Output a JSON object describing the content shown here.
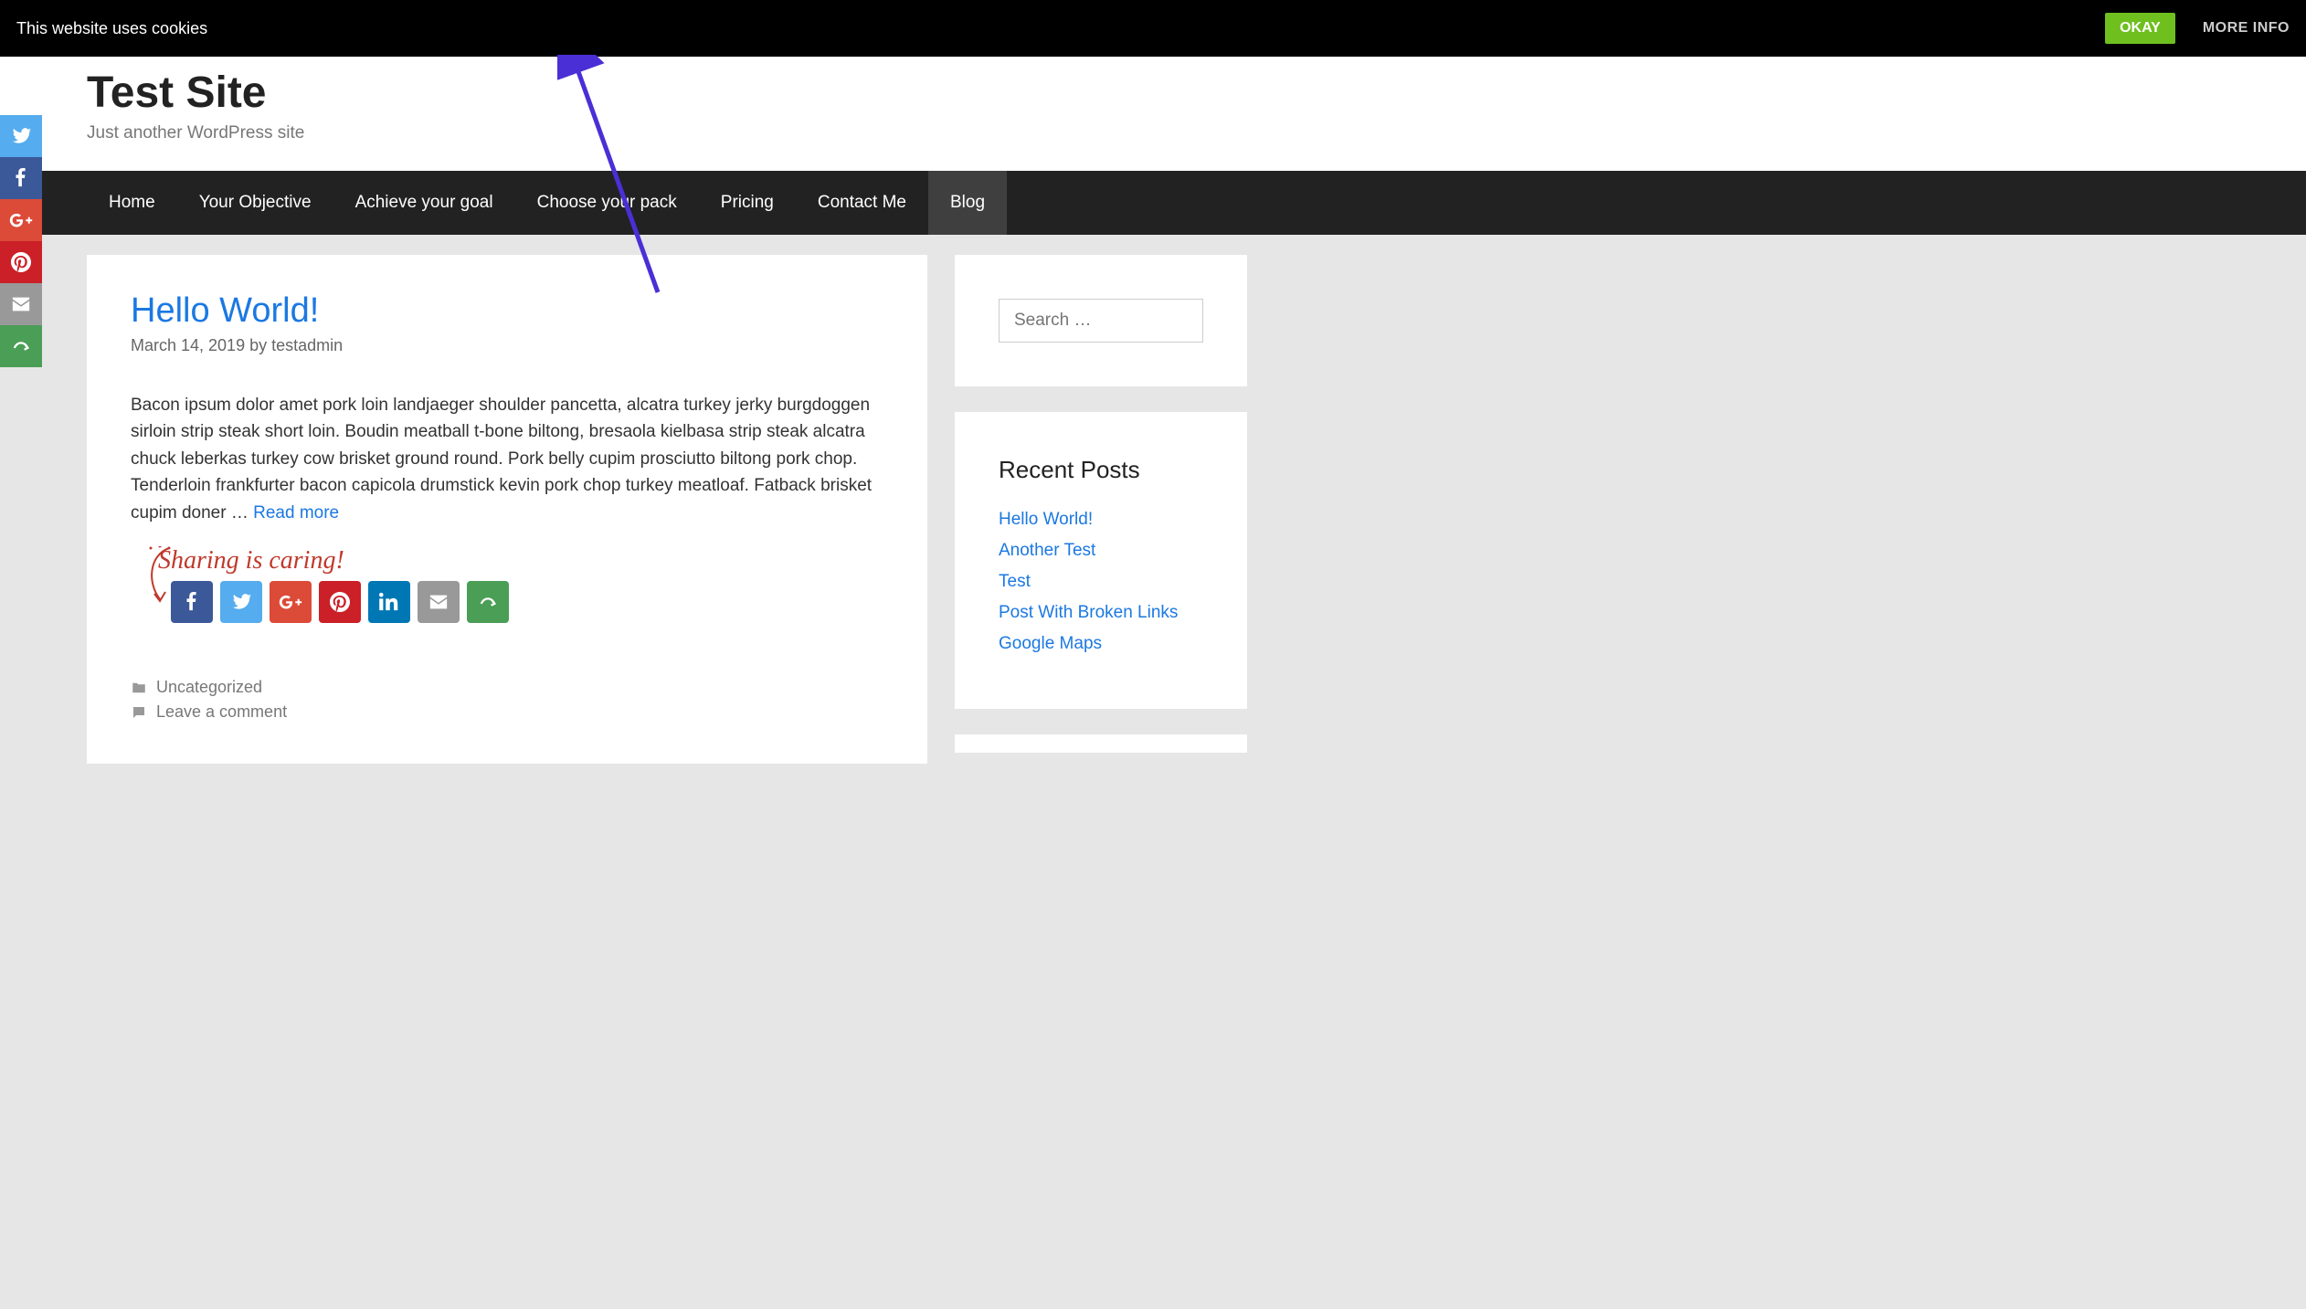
{
  "cookie": {
    "text": "This website uses cookies",
    "okay": "OKAY",
    "more": "MORE INFO"
  },
  "site": {
    "title": "Test Site",
    "tagline": "Just another WordPress site"
  },
  "nav": {
    "items": [
      "Home",
      "Your Objective",
      "Achieve your goal",
      "Choose your pack",
      "Pricing",
      "Contact Me",
      "Blog"
    ],
    "active_index": 6
  },
  "post": {
    "title": "Hello World!",
    "date": "March 14, 2019",
    "by_prefix": "by",
    "author": "testadmin",
    "excerpt": "Bacon ipsum dolor amet pork loin landjaeger shoulder pancetta, alcatra turkey jerky burgdoggen sirloin strip steak short loin. Boudin meatball t-bone biltong, bresaola kielbasa strip steak alcatra chuck leberkas turkey cow brisket ground round. Pork belly cupim prosciutto biltong pork chop. Tenderloin frankfurter bacon capicola drumstick kevin pork chop turkey meatloaf. Fatback brisket cupim doner … ",
    "read_more": "Read more",
    "sharing_label": "Sharing is caring!",
    "category": "Uncategorized",
    "comment_label": "Leave a comment"
  },
  "share_buttons": [
    "facebook",
    "twitter",
    "google-plus",
    "pinterest",
    "linkedin",
    "email",
    "more"
  ],
  "side_share": [
    "twitter",
    "facebook",
    "google-plus",
    "pinterest",
    "email",
    "more"
  ],
  "sidebar": {
    "search_placeholder": "Search …",
    "recent_title": "Recent Posts",
    "recent": [
      "Hello World!",
      "Another Test",
      "Test",
      "Post With Broken Links",
      "Google Maps"
    ]
  },
  "colors": {
    "accent": "#1b78e2",
    "okay_bg": "#6fbf1f",
    "sharing_text": "#c0392b"
  }
}
